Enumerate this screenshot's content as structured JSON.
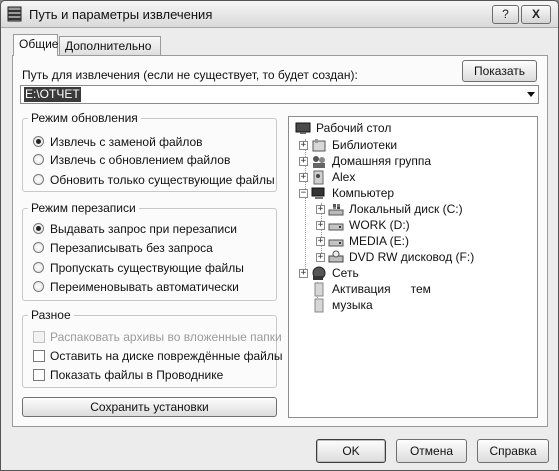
{
  "window": {
    "title": "Путь и параметры извлечения",
    "help_button": "?",
    "close_button": "X"
  },
  "tabs": [
    {
      "label": "Общие",
      "active": true
    },
    {
      "label": "Дополнительно",
      "active": false
    }
  ],
  "path": {
    "label": "Путь для извлечения (если не существует, то будет создан):",
    "show_button": "Показать",
    "value": "E:\\ОТЧЕТ"
  },
  "update_mode": {
    "title": "Режим обновления",
    "options": [
      {
        "label": "Извлечь с заменой файлов",
        "selected": true
      },
      {
        "label": "Извлечь с обновлением файлов",
        "selected": false
      },
      {
        "label": "Обновить только существующие файлы",
        "selected": false
      }
    ]
  },
  "overwrite_mode": {
    "title": "Режим перезаписи",
    "options": [
      {
        "label": "Выдавать запрос при перезаписи",
        "selected": true
      },
      {
        "label": "Перезаписывать без запроса",
        "selected": false
      },
      {
        "label": "Пропускать существующие файлы",
        "selected": false
      },
      {
        "label": "Переименовывать автоматически",
        "selected": false
      }
    ]
  },
  "misc": {
    "title": "Разное",
    "options": [
      {
        "label": "Распаковать архивы во вложенные папки",
        "checked": false,
        "disabled": true
      },
      {
        "label": "Оставить на диске повреждённые файлы",
        "checked": false,
        "disabled": false
      },
      {
        "label": "Показать файлы в Проводнике",
        "checked": false,
        "disabled": false
      }
    ]
  },
  "save_button": "Сохранить установки",
  "tree": [
    {
      "label": "Рабочий стол",
      "icon": "desktop-icon"
    },
    {
      "label": "Библиотеки",
      "icon": "libraries-icon"
    },
    {
      "label": "Домашняя группа",
      "icon": "homegroup-icon"
    },
    {
      "label": "Alex",
      "icon": "user-folder-icon"
    },
    {
      "label": "Компьютер",
      "icon": "computer-icon"
    },
    {
      "label": "Локальный диск (C:)",
      "icon": "system-drive-icon"
    },
    {
      "label": "WORK (D:)",
      "icon": "drive-icon"
    },
    {
      "label": "MEDIA (E:)",
      "icon": "drive-icon"
    },
    {
      "label": "DVD RW дисковод (F:)",
      "icon": "dvd-drive-icon"
    },
    {
      "label": "Сеть",
      "icon": "network-icon"
    },
    {
      "label": "Активация      тем",
      "icon": "folder-icon"
    },
    {
      "label": "музыка",
      "icon": "folder-icon"
    }
  ],
  "buttons": {
    "ok": "OK",
    "cancel": "Отмена",
    "help": "Справка"
  }
}
